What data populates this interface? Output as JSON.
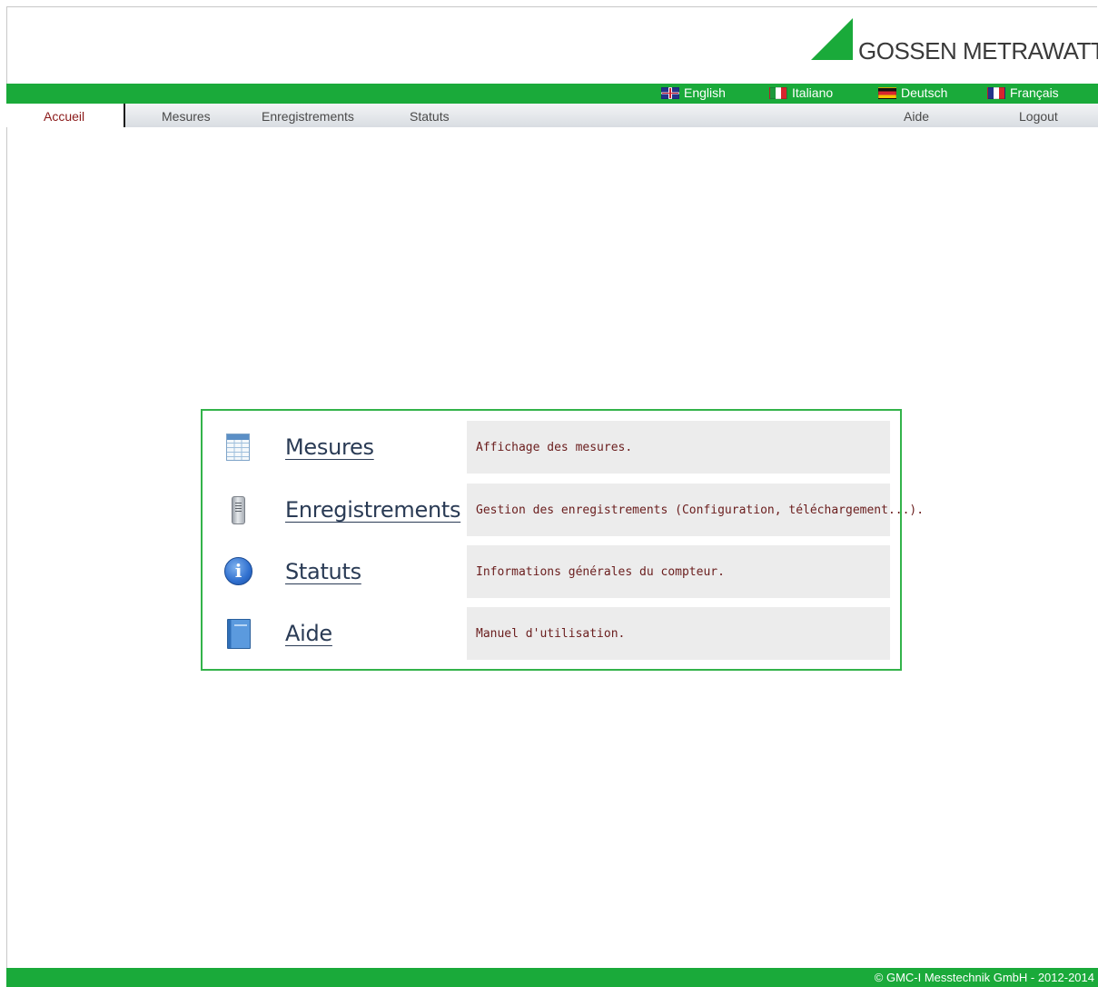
{
  "brand": {
    "name": "GOSSEN METRAWATT",
    "color": "#1aaa3a"
  },
  "languages": [
    {
      "label": "English",
      "flag": "uk-flag-icon"
    },
    {
      "label": "Italiano",
      "flag": "italy-flag-icon"
    },
    {
      "label": "Deutsch",
      "flag": "germany-flag-icon"
    },
    {
      "label": "Français",
      "flag": "france-flag-icon"
    }
  ],
  "nav": {
    "active": "Accueil",
    "items": [
      "Mesures",
      "Enregistrements",
      "Statuts"
    ],
    "help": "Aide",
    "logout": "Logout"
  },
  "main": {
    "rows": [
      {
        "title": "Mesures",
        "description": "Affichage des mesures.",
        "icon": "table-icon"
      },
      {
        "title": "Enregistrements",
        "description": "Gestion des enregistrements (Configuration, téléchargement...).",
        "icon": "server-icon"
      },
      {
        "title": "Statuts",
        "description": "Informations générales du compteur.",
        "icon": "info-icon"
      },
      {
        "title": "Aide",
        "description": "Manuel d'utilisation.",
        "icon": "book-icon"
      }
    ]
  },
  "footer": {
    "text": "© GMC-I Messtechnik GmbH - 2012-2014"
  }
}
